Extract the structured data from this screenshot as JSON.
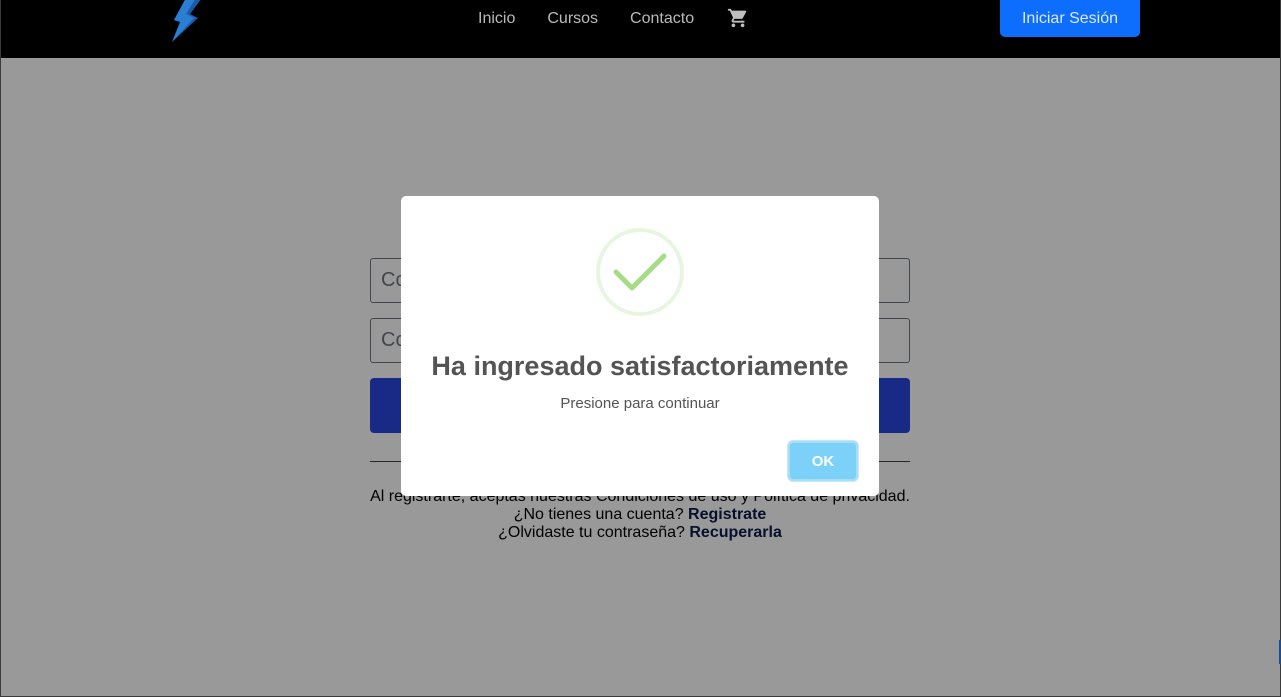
{
  "navbar": {
    "logo_icon": "lightning-bolt-logo",
    "links": [
      {
        "label": "Inicio"
      },
      {
        "label": "Cursos"
      },
      {
        "label": "Contacto"
      }
    ],
    "cart_icon": "shopping-cart-icon",
    "login_button": "Iniciar Sesión"
  },
  "form": {
    "email_placeholder": "Co",
    "password_placeholder": "Co",
    "submit_label": "",
    "terms_text": "Al registrarte, aceptas nuestras Condiciones de uso y Política de privacidad.",
    "register_prompt": "¿No tienes una cuenta?",
    "register_link": "Registrate",
    "forgot_prompt": "¿Olvidaste tu contraseña?",
    "forgot_link": "Recuperarla"
  },
  "modal": {
    "icon": "success-check-icon",
    "title": "Ha ingresado satisfactoriamente",
    "text": "Presione para continuar",
    "ok_label": "OK"
  },
  "colors": {
    "navbar_bg": "#000000",
    "primary_button": "#0d6efd",
    "submit_button": "#2846e0",
    "ok_button": "#7cd1f9",
    "success_green": "#a5dc86"
  }
}
